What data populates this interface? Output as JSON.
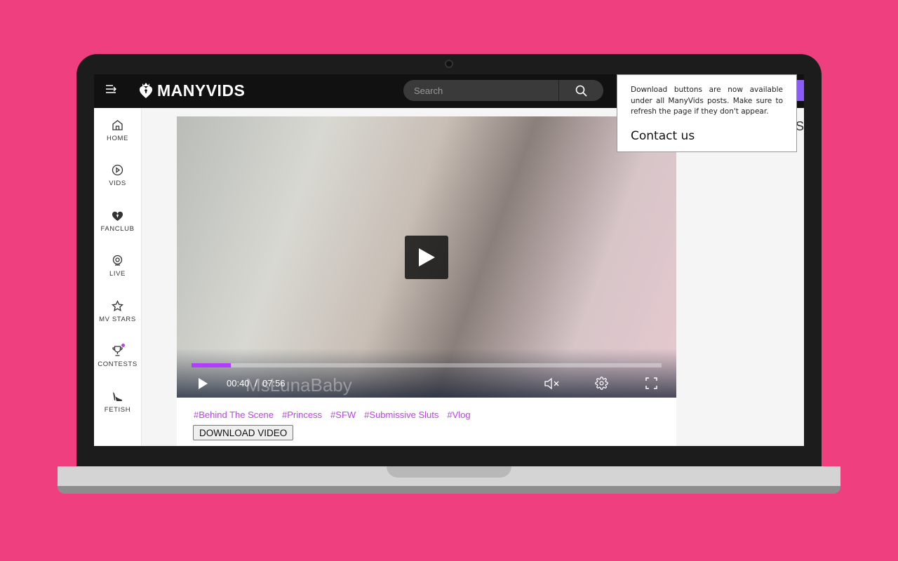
{
  "header": {
    "logo": "MANYVIDS",
    "search_placeholder": "Search"
  },
  "sidebar": {
    "items": [
      {
        "label": "HOME",
        "icon": "home-icon"
      },
      {
        "label": "VIDS",
        "icon": "play-circle-icon"
      },
      {
        "label": "FANCLUB",
        "icon": "heart-lock-icon"
      },
      {
        "label": "LIVE",
        "icon": "webcam-icon"
      },
      {
        "label": "MV STARS",
        "icon": "star-icon"
      },
      {
        "label": "CONTESTS",
        "icon": "trophy-icon"
      },
      {
        "label": "FETISH",
        "icon": "high-heel-icon"
      }
    ]
  },
  "video": {
    "current_time": "00:40",
    "separator": "/",
    "duration": "07:56",
    "progress_percent": 8.4,
    "watermark": "MsLunaBaby",
    "accent": "#b23cff"
  },
  "tags": [
    "#Behind The Scene",
    "#Princess",
    "#SFW",
    "#Submissive Sluts",
    "#Vlog"
  ],
  "download_label": "DOWNLOAD VIDEO",
  "right_partial": "S",
  "popup": {
    "message": "Download buttons are now available under all ManyVids posts. Make sure to refresh the page if they don't appear.",
    "contact": "Contact us"
  },
  "colors": {
    "background": "#ef3f7f",
    "tag": "#c040f0",
    "header": "#111111"
  }
}
